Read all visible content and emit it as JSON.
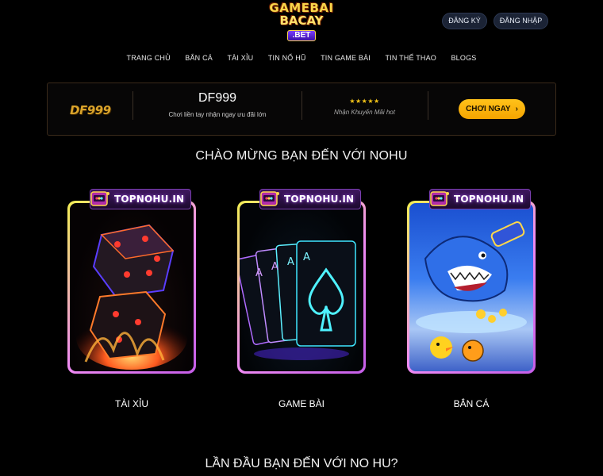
{
  "header": {
    "logo": {
      "line1": "GAMEBAI",
      "line2": "BACAY",
      "line3": ".BET"
    },
    "register_label": "ĐĂNG KÝ",
    "login_label": "ĐĂNG NHẬP"
  },
  "nav": {
    "items": [
      {
        "label": "TRANG CHỦ"
      },
      {
        "label": "BẮN CÁ"
      },
      {
        "label": "TÀI XỈU"
      },
      {
        "label": "TIN NỔ HŨ"
      },
      {
        "label": "TIN GAME BÀI"
      },
      {
        "label": "TIN THỂ THAO"
      },
      {
        "label": "BLOGS"
      }
    ]
  },
  "banner": {
    "brand_logo_text": "DF999",
    "name": "DF999",
    "description": "Chơi liền tay nhận ngay ưu đãi lớn",
    "stars": "★★★★★",
    "promo": "Nhận Khuyến Mãi hot",
    "cta_label": "CHƠI NGAY",
    "cta_chevron": "›"
  },
  "welcome_title": "CHÀO MỪNG BẠN ĐẾN VỚI NOHU",
  "cards": [
    {
      "tag": "TOPNOHU.IN",
      "label": "TÀI XỈU"
    },
    {
      "tag": "TOPNOHU.IN",
      "label": "GAME BÀI"
    },
    {
      "tag": "TOPNOHU.IN",
      "label": "BẮN CÁ"
    }
  ],
  "bottom_title": "LẦN ĐẦU BẠN ĐẾN VỚI NO HU?",
  "colors": {
    "background": "#000000",
    "cta": "#ffb300",
    "card_border_start": "#f3ef53",
    "card_border_end": "#c55de8",
    "auth_button": "#1b2335"
  }
}
